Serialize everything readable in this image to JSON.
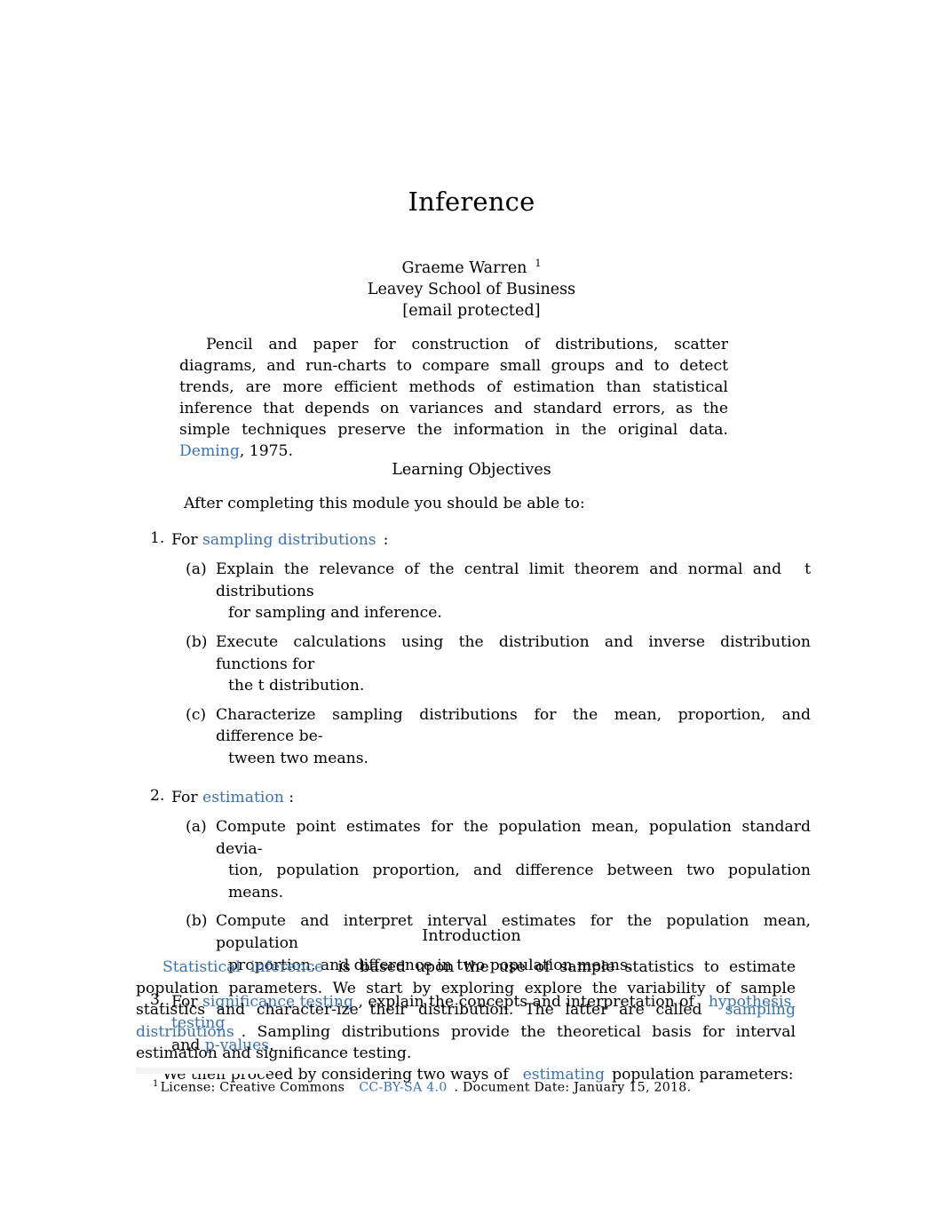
{
  "document": {
    "title": "Inference",
    "author": {
      "name": "Graeme Warren",
      "footnote_marker": "1",
      "affiliation": "Leavey School of Business",
      "email": "[email protected]"
    },
    "abstract": {
      "text_before_link": "Pencil and paper for construction of distributions, scatter diagrams, and run-charts to compare small groups and to detect trends, are more efficient methods of estimation than statistical inference that depends on variances and standard errors, as the simple techniques preserve the information in the original data.",
      "citation_link": "Deming",
      "citation_year": ", 1975."
    },
    "learning_objectives": {
      "heading": "Learning Objectives",
      "lead_in": "After completing this module you should be able to:",
      "items": [
        {
          "marker": "1.",
          "prefix": "For",
          "link": "sampling distributions",
          "suffix": ":",
          "subitems": [
            {
              "marker": "(a)",
              "text_1": "Explain the relevance of the central limit theorem and normal and",
              "math": "t",
              "text_2": "distributions",
              "continuation": "for sampling and inference."
            },
            {
              "marker": "(b)",
              "text_1": "Execute calculations using the distribution and inverse distribution functions for",
              "continuation_pre": "the",
              "math": "t",
              "continuation_post": "distribution."
            },
            {
              "marker": "(c)",
              "text_1": "Characterize sampling distributions for the mean, proportion, and difference be-",
              "continuation": "tween two means."
            }
          ]
        },
        {
          "marker": "2.",
          "prefix": "For",
          "link": "estimation",
          "suffix": ":",
          "subitems": [
            {
              "marker": "(a)",
              "text_1": "Compute point estimates for the population mean, population standard devia-",
              "continuation": "tion, population proportion, and difference between two population means."
            },
            {
              "marker": "(b)",
              "text_1": "Compute and interpret interval estimates for the population mean, population",
              "continuation": "proportion, and difference in two population means."
            }
          ]
        },
        {
          "marker": "3.",
          "prefix": "For",
          "link": "significance testing",
          "mid_text": ", explain the concepts and interpretation of",
          "link2": "hypothesis testing",
          "tail_text": "and",
          "link3": "p-values",
          "end": "."
        }
      ]
    },
    "introduction": {
      "heading": "Introduction",
      "para1_link": "Statistical inference",
      "para1_text_1": "is based upon the use of sample statistics to estimate population parameters. We start by exploring explore the variability of sample statistics and character-ize their distribution. The latter are called",
      "para1_link2": "sampling distributions",
      "para1_text_2": ". Sampling distributions provide the theoretical basis for interval estimation and significance testing.",
      "para2_text_1": "We then proceed by considering two ways of",
      "para2_link": "estimating",
      "para2_text_2": "population parameters:"
    },
    "footnote": {
      "marker": "1",
      "text_1": "License: Creative Commons",
      "link": "CC-BY-SA 4.0",
      "text_2": ". Document Date: January 15, 2018."
    }
  },
  "colors": {
    "link": "#3b72b0",
    "text": "#000000",
    "background": "#ffffff"
  }
}
